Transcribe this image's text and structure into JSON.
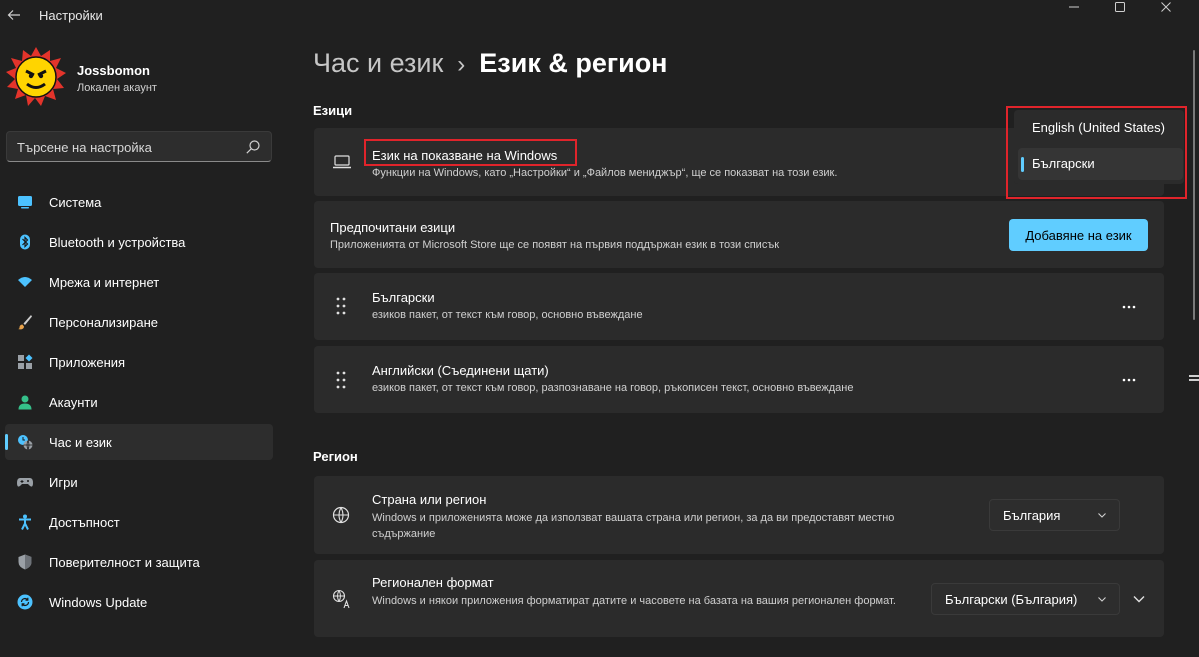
{
  "window": {
    "title": "Настройки",
    "back_icon": "arrow-left-icon",
    "controls": [
      "minimize-icon",
      "maximize-icon",
      "close-icon"
    ]
  },
  "profile": {
    "name": "Jossbomon",
    "account_type": "Локален акаунт"
  },
  "search": {
    "placeholder": "Търсене на настройка",
    "icon": "search-icon"
  },
  "nav": [
    {
      "label": "Система",
      "icon": "monitor-icon",
      "color": "#4cc2ff"
    },
    {
      "label": "Bluetooth и устройства",
      "icon": "bluetooth-icon",
      "color": "#4cc2ff"
    },
    {
      "label": "Мрежа и интернет",
      "icon": "wifi-icon",
      "color": "#4cc2ff"
    },
    {
      "label": "Персонализиране",
      "icon": "brush-icon",
      "color": "#e8a34c"
    },
    {
      "label": "Приложения",
      "icon": "apps-icon",
      "color": "#9aa0a6"
    },
    {
      "label": "Акаунти",
      "icon": "person-icon",
      "color": "#35c08a"
    },
    {
      "label": "Час и език",
      "icon": "clock-globe-icon",
      "color": "#4cc2ff",
      "active": true
    },
    {
      "label": "Игри",
      "icon": "gamepad-icon",
      "color": "#9aa0a6"
    },
    {
      "label": "Достъпност",
      "icon": "accessibility-icon",
      "color": "#4cc2ff"
    },
    {
      "label": "Поверителност и защита",
      "icon": "shield-icon",
      "color": "#9aa0a6"
    },
    {
      "label": "Windows Update",
      "icon": "update-icon",
      "color": "#4cc2ff"
    }
  ],
  "breadcrumb": {
    "parent": "Час и език",
    "separator": "›",
    "current": "Език & регион"
  },
  "languages": {
    "section_title": "Езици",
    "display_language": {
      "title": "Език на показване на Windows",
      "description": "Функции на Windows, като „Настройки“ и „Файлов мениджър“, ще се показват на този език.",
      "icon": "laptop-icon"
    },
    "preferred": {
      "title": "Предпочитани езици",
      "description": "Приложенията от Microsoft Store ще се появят на първия поддържан език в този списък",
      "add_button": "Добавяне на език"
    },
    "list": [
      {
        "name": "Български",
        "features": "езиков пакет, от текст към говор, основно въвеждане"
      },
      {
        "name": "Английски (Съединени щати)",
        "features": "езиков пакет, от текст към говор, разпознаване на говор, ръкописен текст, основно въвеждане"
      }
    ]
  },
  "display_language_popup": {
    "options": [
      "English (United States)",
      "Български"
    ],
    "selected": "Български"
  },
  "region": {
    "section_title": "Регион",
    "country": {
      "title": "Страна или регион",
      "description": "Windows и приложенията може да използват вашата страна или регион, за да ви предоставят местно съдържание",
      "value": "България",
      "icon": "globe-icon"
    },
    "format": {
      "title": "Регионален формат",
      "description": "Windows и някои приложения форматират датите и часовете на базата на вашия регионален формат.",
      "value": "Български (България)",
      "icon": "regional-format-icon"
    }
  },
  "colors": {
    "accent": "#60cdff",
    "background": "#202020",
    "card": "#2b2b2b",
    "highlight": "#e0242b"
  }
}
